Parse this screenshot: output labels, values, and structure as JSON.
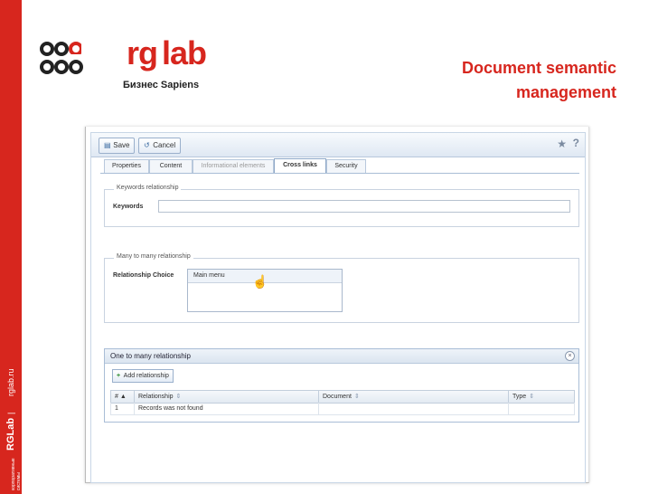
{
  "sidebar": {
    "tagline_line1": "корпоративные",
    "tagline_line2": "системы",
    "brand": "RGLab",
    "separator": "|",
    "site": "rglab.ru",
    "color": "#d7261e"
  },
  "logo": {
    "mark": "rg",
    "word": "lab",
    "subtitle": "Бизнес Sapiens"
  },
  "slide": {
    "title_line1": "Document semantic",
    "title_line2": "management"
  },
  "toolbar": {
    "save_label": "Save",
    "cancel_label": "Cancel",
    "star_icon": "star-icon",
    "help_label": "?"
  },
  "tabs": [
    {
      "label": "Properties"
    },
    {
      "label": "Content"
    },
    {
      "label": "Informational elements"
    },
    {
      "label": "Cross links"
    },
    {
      "label": "Security"
    }
  ],
  "keywords_section": {
    "legend": "Keywords relationship",
    "label": "Keywords",
    "value": ""
  },
  "many_section": {
    "legend": "Many to many relationship",
    "label": "Relationship Choice",
    "options": [
      "Main menu"
    ]
  },
  "one_section": {
    "title": "One to many relationship",
    "add_button": "Add relationship",
    "columns": [
      "# ▲",
      "Relationship",
      "Document",
      "Type"
    ],
    "rows": [
      [
        "1",
        "Records was not found",
        "",
        ""
      ]
    ]
  }
}
